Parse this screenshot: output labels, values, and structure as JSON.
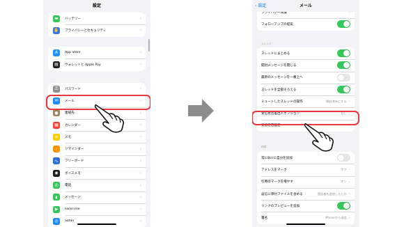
{
  "left_screen": {
    "title": "設定",
    "groups": [
      {
        "items": [
          {
            "label": "バッテリー",
            "icon": "battery-icon",
            "color": "#34c759",
            "glyph": "▬"
          },
          {
            "label": "プライバシーとセキュリティ",
            "icon": "hand-privacy-icon",
            "color": "#3478f6",
            "glyph": "✋"
          }
        ]
      },
      {
        "items": [
          {
            "label": "App Store",
            "icon": "app-store-icon",
            "color": "#1e90ff",
            "glyph": "A"
          },
          {
            "label": "ウォレットと Apple Pay",
            "icon": "wallet-icon",
            "color": "#222222",
            "glyph": "▤"
          }
        ]
      },
      {
        "items": [
          {
            "label": "パスワード",
            "icon": "key-icon",
            "color": "#8e8e93",
            "glyph": "⚿"
          },
          {
            "label": "メール",
            "icon": "mail-icon",
            "color": "#1a8cff",
            "glyph": "✉"
          },
          {
            "label": "連絡先",
            "icon": "contacts-icon",
            "color": "#a2845e",
            "glyph": "●"
          },
          {
            "label": "カレンダー",
            "icon": "calendar-icon",
            "color": "#ff3b30",
            "glyph": "▦"
          },
          {
            "label": "メモ",
            "icon": "notes-icon",
            "color": "#ffcc00",
            "glyph": "≡"
          },
          {
            "label": "リマインダー",
            "icon": "reminders-icon",
            "color": "#ff9500",
            "glyph": "⁝"
          },
          {
            "label": "フリーボード",
            "icon": "freeform-icon",
            "color": "#2f6fd6",
            "glyph": "∿"
          },
          {
            "label": "ボイスメモ",
            "icon": "voice-memo-icon",
            "color": "#1c1c1e",
            "glyph": "◉"
          },
          {
            "label": "電話",
            "icon": "phone-icon",
            "color": "#34c759",
            "glyph": "✆"
          },
          {
            "label": "メッセージ",
            "icon": "messages-icon",
            "color": "#34c759",
            "glyph": "◖"
          },
          {
            "label": "FaceTime",
            "icon": "facetime-icon",
            "color": "#34c759",
            "glyph": "▶"
          },
          {
            "label": "Safari",
            "icon": "safari-icon",
            "color": "#1a8cff",
            "glyph": "◎"
          }
        ]
      }
    ]
  },
  "right_screen": {
    "back_label": "設定",
    "title": "メール",
    "group1": [
      {
        "label": "プライバシー保護",
        "type": "chevron"
      },
      {
        "label": "フォローアップの提案",
        "type": "toggle",
        "on": true
      }
    ],
    "thread_header": "スレッド",
    "group2": [
      {
        "label": "スレッドにまとめる",
        "type": "toggle",
        "on": true
      },
      {
        "label": "開封メッセージを閉じる",
        "type": "toggle",
        "on": true
      },
      {
        "label": "最新のメッセージを一番上へ",
        "type": "toggle",
        "on": false
      },
      {
        "label": "スレッドを全部そろえる",
        "type": "toggle",
        "on": true
      },
      {
        "label": "ミュートしたスレッドの操作",
        "type": "value",
        "value": "開封済みにする"
      },
      {
        "label": "受信拒否差出人オプション",
        "type": "value",
        "value": "なし"
      },
      {
        "label": "受信拒否設定",
        "type": "chevron"
      }
    ],
    "compose_header": "作成",
    "group3": [
      {
        "label": "常にBccに自分を追加",
        "type": "toggle",
        "on": false
      },
      {
        "label": "アドレスをマーク",
        "type": "value",
        "value": "オフ"
      },
      {
        "label": "引用のマークを増やす",
        "type": "value",
        "value": "オン"
      },
      {
        "label": "返信に添付ファイルを含める",
        "type": "value",
        "value": "受信者を追加したとき"
      },
      {
        "label": "リンクのプレビューを追加",
        "type": "toggle",
        "on": true
      },
      {
        "label": "署名",
        "type": "value",
        "value": "iPhoneから送信"
      }
    ]
  },
  "colors": {
    "accent": "#007aff",
    "highlight": "#e8383d",
    "toggle_on": "#34c759",
    "arrow": "#8c8c8c"
  }
}
